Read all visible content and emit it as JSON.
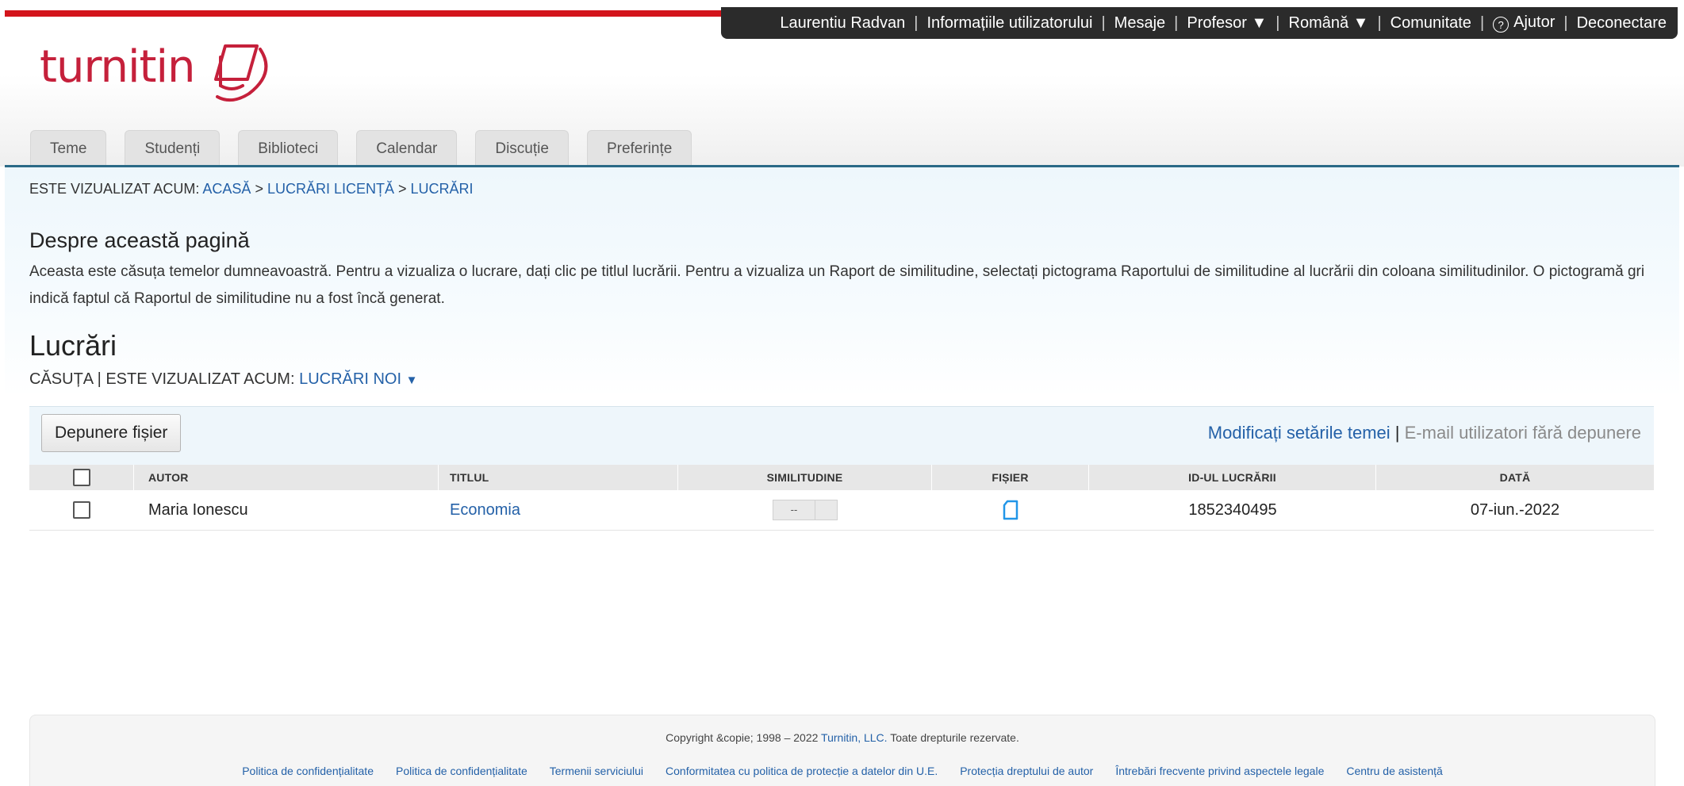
{
  "colors": {
    "brand_red": "#d3141b",
    "link_blue": "#2461a8",
    "topbar_bg": "#2b2b2b",
    "rule_blue": "#2b6a87"
  },
  "topbar": {
    "user_name": "Laurentiu Radvan",
    "user_info": "Informațiile utilizatorului",
    "messages": "Mesaje",
    "role": "Profesor ▼",
    "language": "Română ▼",
    "community": "Comunitate",
    "help_icon": "question-circle-icon",
    "help": "Ajutor",
    "logout": "Deconectare",
    "separator": "|"
  },
  "logo": {
    "text": "turnitin",
    "icon": "turnitin-page-icon"
  },
  "tabs": [
    {
      "label": "Teme"
    },
    {
      "label": "Studenți"
    },
    {
      "label": "Biblioteci"
    },
    {
      "label": "Calendar"
    },
    {
      "label": "Discuție"
    },
    {
      "label": "Preferințe"
    }
  ],
  "breadcrumb": {
    "prefix": "ESTE VIZUALIZAT ACUM:",
    "items": [
      "ACASĂ",
      "LUCRĂRI LICENȚĂ",
      "LUCRĂRI"
    ],
    "separator": ">"
  },
  "about": {
    "title": "Despre această pagină",
    "text": "Aceasta este căsuța temelor dumneavoastră. Pentru a vizualiza o lucrare, dați clic pe titlul lucrării. Pentru a vizualiza un Raport de similitudine, selectați pictograma Raportului de similitudine al lucrării din coloana similitudinilor. O pictogramă gri indică faptul că Raportul de similitudine nu a fost încă generat."
  },
  "page_title": "Lucrări",
  "view": {
    "prefix": "CĂSUȚA  | ESTE VIZUALIZAT ACUM:",
    "selected": "LUCRĂRI NOI",
    "arrow": "▼"
  },
  "toolbar": {
    "upload_label": "Depunere fișier",
    "settings_link": "Modificați setările temei",
    "separator": "|",
    "email_link": "E-mail utilizatori fără depunere"
  },
  "table": {
    "columns": [
      "AUTOR",
      "TITLUL",
      "SIMILITUDINE",
      "FIȘIER",
      "ID-UL LUCRĂRII",
      "DATĂ"
    ],
    "rows": [
      {
        "author": "Maria Ionescu",
        "title": "Economia",
        "similarity": "--",
        "file_icon": "document-icon",
        "paper_id": "1852340495",
        "date": "07-iun.-2022"
      }
    ]
  },
  "footer": {
    "copyright_prefix": "Copyright &copie; 1998 – 2022",
    "copyright_company": "Turnitin, LLC.",
    "copyright_suffix": "Toate drepturile rezervate.",
    "links": [
      "Politica de confidențialitate",
      "Politica de confidențialitate",
      "Termenii serviciului",
      "Conformitatea cu politica de protecție a datelor din U.E.",
      "Protecția dreptului de autor",
      "Întrebări frecvente privind aspectele legale",
      "Centru de asistență"
    ]
  }
}
